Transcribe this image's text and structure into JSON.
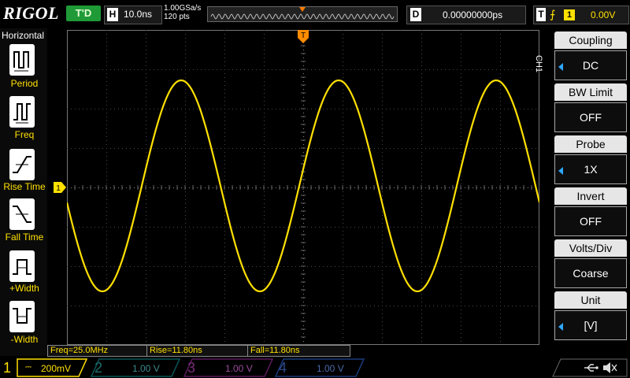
{
  "top_bar": {
    "logo": "RIGOL",
    "run_status": "T'D",
    "timebase_key": "H",
    "timebase": "10.0ns",
    "sample_rate": "1.00GSa/s",
    "memory_depth": "120 pts",
    "delay_key": "D",
    "delay": "0.00000000ps",
    "trigger_key": "T",
    "trigger_edge": "⨍",
    "trigger_source": "1",
    "trigger_level": "0.00V"
  },
  "left_menu": {
    "title": "Horizontal",
    "items": [
      {
        "label": "Period"
      },
      {
        "label": "Freq"
      },
      {
        "label": "Rise Time"
      },
      {
        "label": "Fall Time"
      },
      {
        "label": "+Width"
      },
      {
        "label": "-Width"
      }
    ]
  },
  "right_menu": {
    "channel": "CH1",
    "items": [
      {
        "title": "Coupling",
        "value": "DC"
      },
      {
        "title": "BW Limit",
        "value": "OFF"
      },
      {
        "title": "Probe",
        "value": "1X"
      },
      {
        "title": "Invert",
        "value": "OFF"
      },
      {
        "title": "Volts/Div",
        "value": "Coarse"
      },
      {
        "title": "Unit",
        "value": "[V]"
      }
    ]
  },
  "measurements": {
    "freq": "Freq=25.0MHz",
    "rise": "Rise=11.80ns",
    "fall": "Fall=11.80ns"
  },
  "channels": [
    {
      "num": "1",
      "scale": "200mV",
      "color": "#ffe000"
    },
    {
      "num": "2",
      "scale": "1.00 V",
      "color": "#00c8c8"
    },
    {
      "num": "3",
      "scale": "1.00 V",
      "color": "#e040e0"
    },
    {
      "num": "4",
      "scale": "1.00 V",
      "color": "#2a7fff"
    }
  ],
  "markers": {
    "channel": "1",
    "trigger": "T"
  },
  "colors": {
    "trace": "#ffe000",
    "grid": "#4a4a4a",
    "accent": "#2ea8ff"
  }
}
